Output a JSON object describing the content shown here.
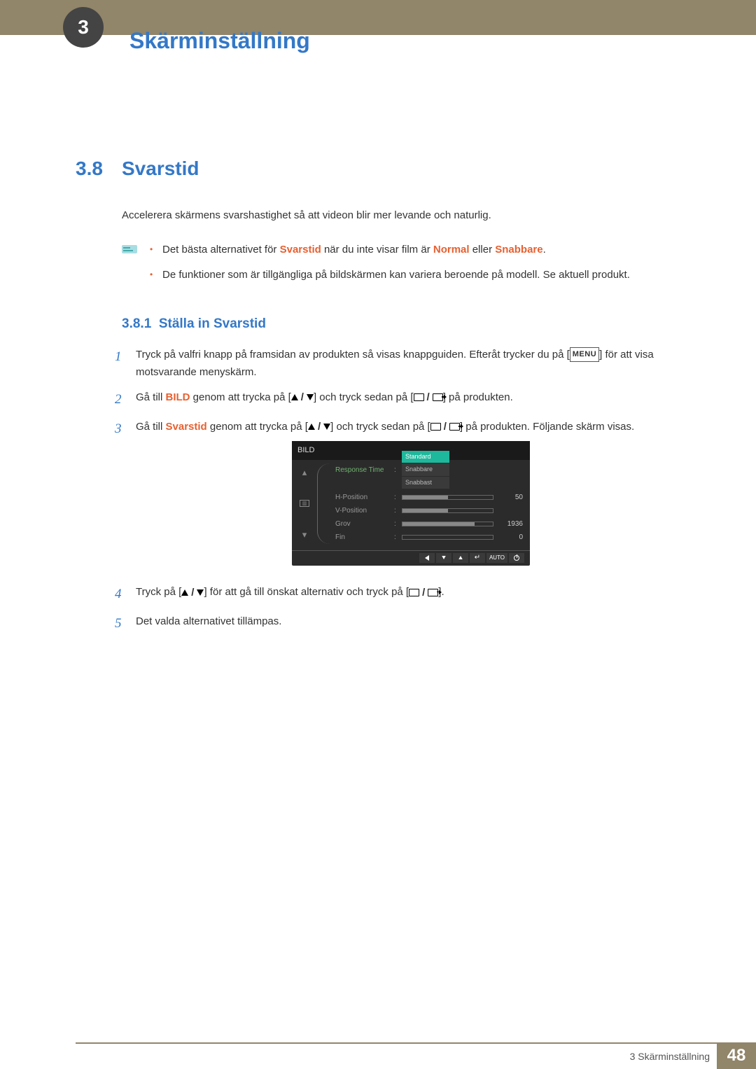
{
  "chapter_number": "3",
  "header_title": "Skärminställning",
  "section_number": "3.8",
  "section_title": "Svarstid",
  "intro_text": "Accelerera skärmens svarshastighet så att videon blir mer levande och naturlig.",
  "notes": {
    "item1": {
      "pre": "Det bästa alternativet för ",
      "hl1": "Svarstid",
      "mid": " när du inte visar film är ",
      "hl2": "Normal",
      "mid2": " eller ",
      "hl3": "Snabbare",
      "post": "."
    },
    "item2": "De funktioner som är tillgängliga på bildskärmen kan variera beroende på modell. Se aktuell produkt."
  },
  "subsection_number": "3.8.1",
  "subsection_title": "Ställa in Svarstid",
  "steps": {
    "s1": {
      "pre": "Tryck på valfri knapp på framsidan av produkten så visas knappguiden. Efteråt trycker du på [",
      "menu": "MENU",
      "post": "] för att visa motsvarande menyskärm."
    },
    "s2": {
      "pre": "Gå till ",
      "hl": "BILD",
      "mid": " genom att trycka på [",
      "mid2": "] och tryck sedan på [",
      "post": "] på produkten."
    },
    "s3": {
      "pre": "Gå till ",
      "hl": "Svarstid",
      "mid": " genom att trycka på [",
      "mid2": "] och tryck sedan på [",
      "post": "] på produkten. Följande skärm visas."
    },
    "s4": {
      "pre": "Tryck på [",
      "mid": "] för att gå till önskat alternativ och tryck på [",
      "post": "]."
    },
    "s5": "Det valda alternativet tillämpas."
  },
  "osd": {
    "title": "BILD",
    "items": {
      "response": "Response Time",
      "hpos": "H-Position",
      "vpos": "V-Position",
      "grov": "Grov",
      "fin": "Fin"
    },
    "options": {
      "o1": "Standard",
      "o2": "Snabbare",
      "o3": "Snabbast"
    },
    "values": {
      "hpos": "50",
      "grov": "1936",
      "fin": "0"
    },
    "auto": "AUTO"
  },
  "footer": {
    "text": "3 Skärminställning",
    "page": "48"
  }
}
